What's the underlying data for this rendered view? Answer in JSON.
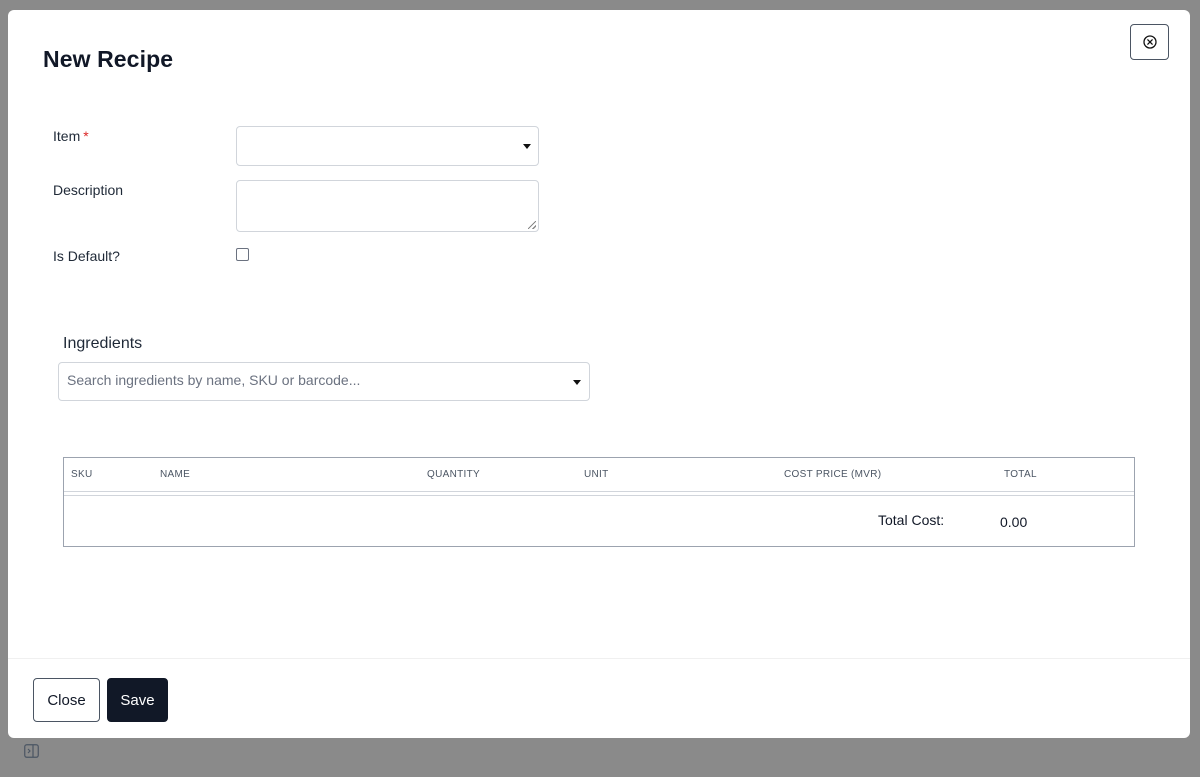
{
  "modal": {
    "title": "New Recipe",
    "close_icon": "circle-x-icon"
  },
  "form": {
    "item": {
      "label": "Item",
      "required_mark": "*",
      "value": ""
    },
    "description": {
      "label": "Description",
      "value": ""
    },
    "is_default": {
      "label": "Is Default?",
      "checked": false
    }
  },
  "ingredients": {
    "label": "Ingredients",
    "search_placeholder": "Search ingredients by name, SKU or barcode..."
  },
  "table": {
    "headers": [
      "SKU",
      "NAME",
      "QUANTITY",
      "UNIT",
      "COST PRICE (MVR)",
      "TOTAL"
    ],
    "rows": [],
    "total_label": "Total Cost:",
    "total_value": "0.00"
  },
  "footer": {
    "close_label": "Close",
    "save_label": "Save"
  },
  "colors": {
    "primary": "#111827",
    "required": "#dc2626",
    "backdrop": "#8a8a8a"
  },
  "icons": {
    "corner": "sidebar-toggle-icon"
  }
}
